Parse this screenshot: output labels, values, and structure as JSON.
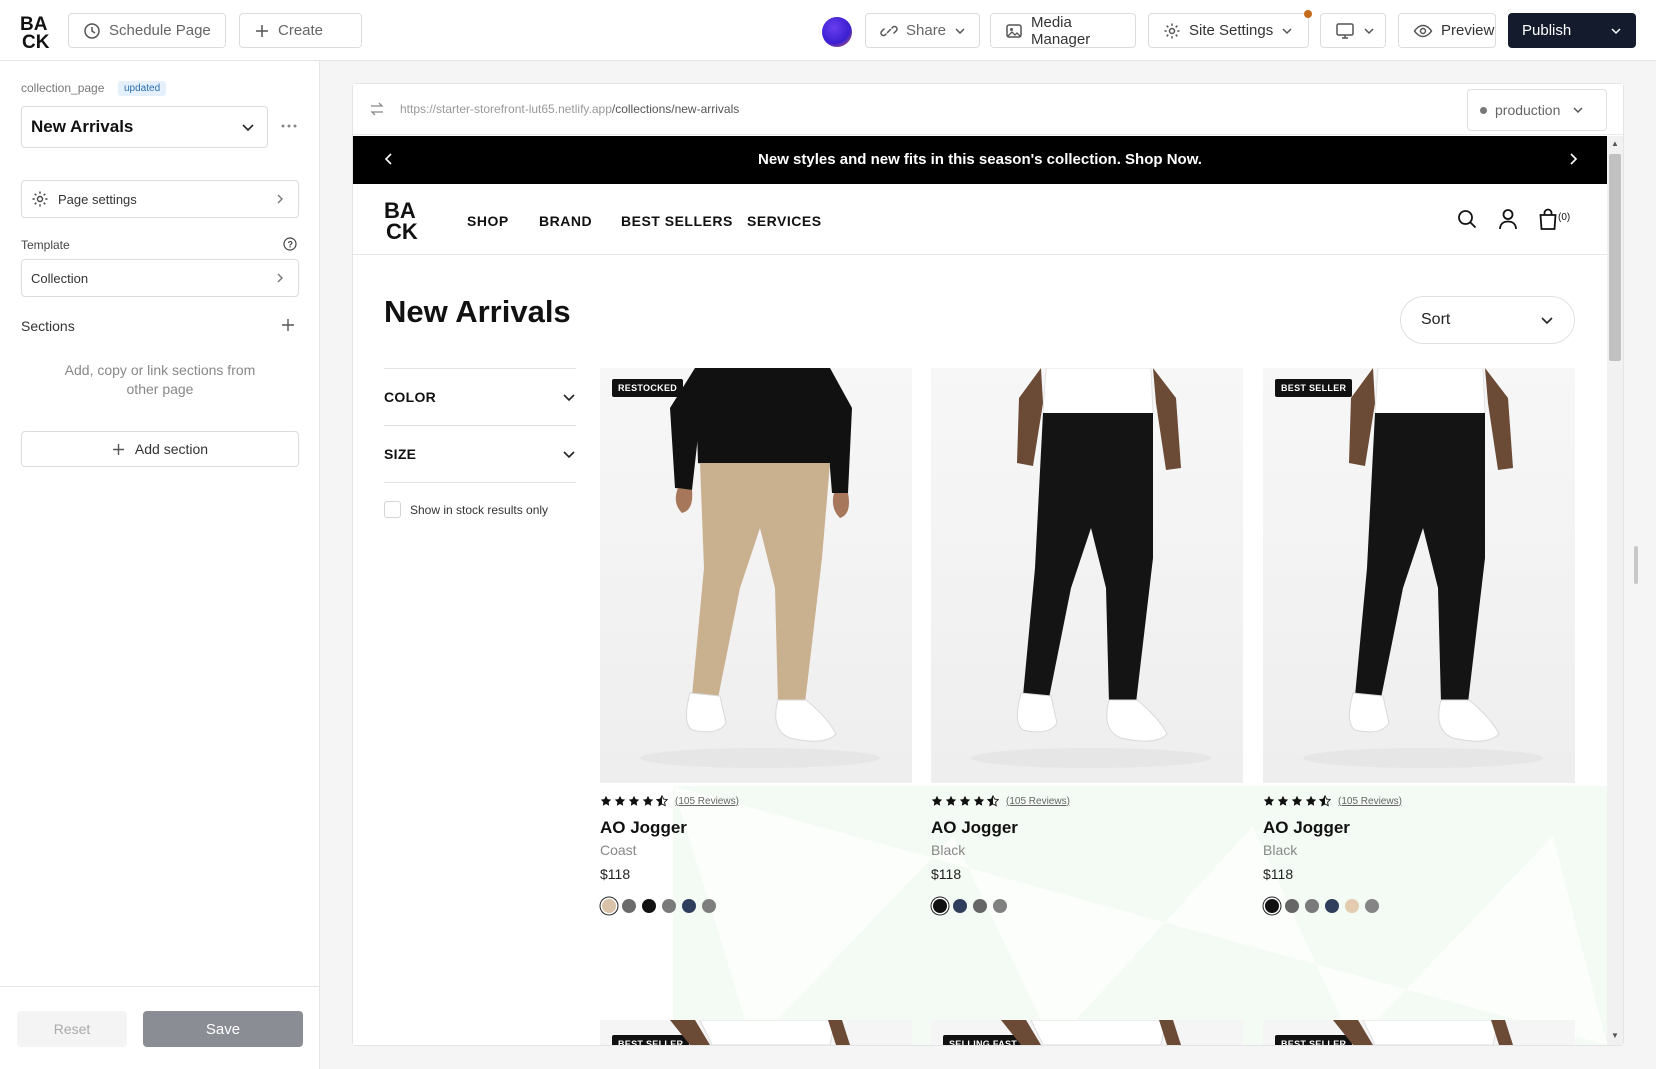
{
  "topbar": {
    "schedule_label": "Schedule Page",
    "create_label": "Create",
    "share_label": "Share",
    "media_manager_label": "Media Manager",
    "site_settings_label": "Site Settings",
    "preview_label": "Preview",
    "publish_label": "Publish"
  },
  "left": {
    "page_type": "collection_page",
    "status_badge": "updated",
    "page_select_value": "New Arrivals",
    "page_settings_label": "Page settings",
    "template_label": "Template",
    "template_value": "Collection",
    "sections_label": "Sections",
    "sections_empty_text": "Add, copy or link sections from other page",
    "add_section_label": "Add section",
    "reset_label": "Reset",
    "save_label": "Save"
  },
  "browser": {
    "url_base": "https://starter-storefront-lut65.netlify.app",
    "url_path": "/collections/new-arrivals",
    "environment": "production"
  },
  "store": {
    "announcement": "New styles and new fits in this season's collection. Shop Now.",
    "nav": [
      "SHOP",
      "BRAND",
      "BEST SELLERS",
      "SERVICES"
    ],
    "cart_count": "(0)",
    "page_title": "New Arrivals",
    "sort_label": "Sort",
    "filters": [
      "COLOR",
      "SIZE"
    ],
    "in_stock_label": "Show in stock results only",
    "products": [
      {
        "badge": "RESTOCKED",
        "reviews": "(105 Reviews)",
        "title": "AO Jogger",
        "color": "Coast",
        "price": "$118",
        "rating": 4.5,
        "pant_color": "#c9b08f",
        "top_color": "#111111",
        "swatches": [
          "#d8c2a8",
          "#6a6a6a",
          "#111111",
          "#7a7a7a",
          "#2f3e5c",
          "#7e7e7e"
        ],
        "selected": 0
      },
      {
        "badge": "",
        "reviews": "(105 Reviews)",
        "title": "AO Jogger",
        "color": "Black",
        "price": "$118",
        "rating": 4.5,
        "pant_color": "#141414",
        "top_color": "#ffffff",
        "swatches": [
          "#111111",
          "#2f3e5c",
          "#666666",
          "#808080"
        ],
        "selected": 0
      },
      {
        "badge": "BEST SELLER",
        "reviews": "(105 Reviews)",
        "title": "AO Jogger",
        "color": "Black",
        "price": "$118",
        "rating": 4.5,
        "pant_color": "#141414",
        "top_color": "#ffffff",
        "swatches": [
          "#111111",
          "#666666",
          "#7a7a7a",
          "#2f3e5c",
          "#e3ccb0",
          "#858585"
        ],
        "selected": 0
      }
    ],
    "next_row_badges": [
      "BEST SELLER",
      "SELLING FAST",
      "BEST SELLER"
    ]
  }
}
